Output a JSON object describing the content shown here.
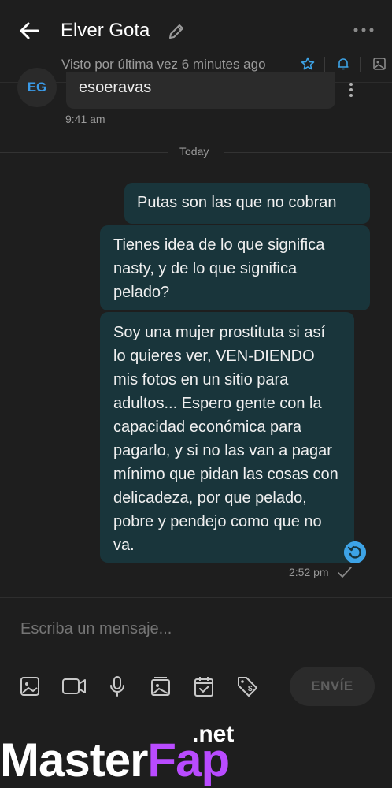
{
  "header": {
    "title": "Elver Gota",
    "status": "Visto por última vez 6 minutes ago"
  },
  "received": {
    "avatar_initials": "EG",
    "text": "esoeravas",
    "time": "9:41 am"
  },
  "divider": {
    "label": "Today"
  },
  "sent": {
    "messages": [
      "Putas son las que no cobran",
      "Tienes idea de lo que significa nasty, y de lo que significa pelado?",
      "Soy una mujer prostituta si así lo quieres ver, VEN-DIENDO mis fotos en un sitio para adultos... Espero gente con la capacidad económica para pagarlo, y si no las van a pagar mínimo que pidan las cosas con delicadeza, por que pelado, pobre y pendejo como que no va."
    ],
    "time": "2:52 pm"
  },
  "composer": {
    "placeholder": "Escriba un mensaje...",
    "send_label": "ENVÍE"
  },
  "watermark": {
    "master": "Master",
    "fap": "Fap",
    "net": ".net"
  },
  "colors": {
    "accent": "#3da3e6",
    "sent_bubble": "#19353b",
    "received_bubble": "#2b2b2b",
    "background": "#1e1e1e"
  }
}
